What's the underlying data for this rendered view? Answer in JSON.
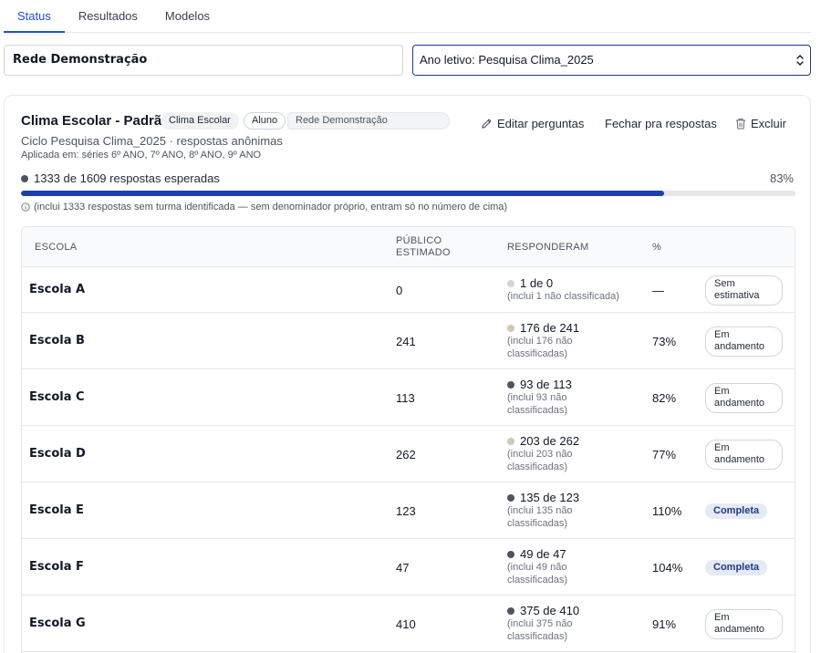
{
  "tabs": [
    {
      "label": "Status",
      "active": true
    },
    {
      "label": "Resultados",
      "active": false
    },
    {
      "label": "Modelos",
      "active": false
    }
  ],
  "rede": {
    "value": "Rede Demonstração"
  },
  "ano_letivo": {
    "value": "Ano letivo: Pesquisa Clima_2025",
    "icon": "chevron-updown-icon"
  },
  "card": {
    "title": "Clima Escolar - Padrão",
    "chips": {
      "type": "Clima Escolar",
      "audience": "Aluno",
      "rede": "Rede Demonstração"
    },
    "actions": {
      "edit": {
        "label": "Editar perguntas",
        "icon": "pencil-icon"
      },
      "close": {
        "label": "Fechar pra respostas"
      },
      "delete": {
        "label": "Excluir",
        "icon": "trash-icon"
      }
    },
    "ciclo": "Ciclo Pesquisa Clima_2025 · respostas anônimas",
    "aplicada": "Aplicada em: séries 6º ANO, 7º ANO, 8º ANO, 9º ANO",
    "progress": {
      "label": "1333 de 1609 respostas esperadas",
      "percent_label": "83%",
      "fraction": 0.83,
      "note": "(inclui 1333 respostas sem turma identificada — sem denominador próprio, entram só no número de cima)",
      "dot_color": "#4b5563",
      "bar_color": "#1e40af"
    },
    "table": {
      "headers": {
        "escola": "ESCOLA",
        "publico_1": "PÚBLICO",
        "publico_2": "ESTIMADO",
        "responderam": "RESPONDERAM",
        "pct": "%"
      },
      "rows": [
        {
          "escola": "Escola A",
          "publico": "0",
          "responderam": "1 de 0",
          "sub1": "(inclui 1 não classificada)",
          "sub2": "",
          "dot": "#d1d5db",
          "pct": "—",
          "status1": "Sem",
          "status2": "estimativa",
          "status_style": "outline"
        },
        {
          "escola": "Escola B",
          "publico": "241",
          "responderam": "176 de 241",
          "sub1": "(inclui 176 não",
          "sub2": "classificadas)",
          "dot": "#cfc8b2",
          "pct": "73%",
          "status1": "Em",
          "status2": "andamento",
          "status_style": "outline"
        },
        {
          "escola": "Escola C",
          "publico": "113",
          "responderam": "93 de 113",
          "sub1": "(inclui 93 não",
          "sub2": "classificadas)",
          "dot": "#4b5563",
          "pct": "82%",
          "status1": "Em",
          "status2": "andamento",
          "status_style": "outline"
        },
        {
          "escola": "Escola D",
          "publico": "262",
          "responderam": "203 de 262",
          "sub1": "(inclui 203 não",
          "sub2": "classificadas)",
          "dot": "#cfc8b2",
          "pct": "77%",
          "status1": "Em",
          "status2": "andamento",
          "status_style": "outline"
        },
        {
          "escola": "Escola E",
          "publico": "123",
          "responderam": "135 de 123",
          "sub1": "(inclui 135 não",
          "sub2": "classificadas)",
          "dot": "#4b5563",
          "pct": "110%",
          "status1": "Completa",
          "status2": "",
          "status_style": "solid"
        },
        {
          "escola": "Escola F",
          "publico": "47",
          "responderam": "49 de 47",
          "sub1": "(inclui 49 não",
          "sub2": "classificadas)",
          "dot": "#4b5563",
          "pct": "104%",
          "status1": "Completa",
          "status2": "",
          "status_style": "solid"
        },
        {
          "escola": "Escola G",
          "publico": "410",
          "responderam": "375 de 410",
          "sub1": "(inclui 375 não",
          "sub2": "classificadas)",
          "dot": "#4b5563",
          "pct": "91%",
          "status1": "Em",
          "status2": "andamento",
          "status_style": "outline"
        }
      ]
    }
  }
}
